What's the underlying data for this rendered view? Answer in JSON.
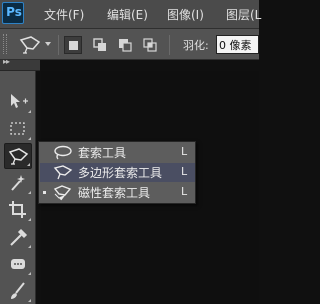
{
  "app": {
    "logo_text": "Ps",
    "brand_color": "#2e82c6"
  },
  "menubar": {
    "items": [
      {
        "label": "文件(F)"
      },
      {
        "label": "编辑(E)"
      },
      {
        "label": "图像(I)"
      },
      {
        "label": "图层(L"
      }
    ]
  },
  "options_bar": {
    "feather_label": "羽化:",
    "feather_value": "0 像素",
    "selection_modes": [
      "new-selection",
      "add-to-selection",
      "subtract-from-selection",
      "intersect-with-selection"
    ]
  },
  "toolbox": {
    "header_glyph": "▸▸",
    "tools": [
      {
        "icon": "move-icon"
      },
      {
        "icon": "marquee-icon"
      },
      {
        "icon": "polygonal-lasso-icon",
        "active": true
      },
      {
        "icon": "magic-wand-icon"
      },
      {
        "icon": "crop-icon"
      },
      {
        "icon": "eyedropper-icon"
      },
      {
        "icon": "spot-healing-icon"
      },
      {
        "icon": "brush-icon"
      }
    ]
  },
  "flyout": {
    "items": [
      {
        "label": "套索工具",
        "shortcut": "L",
        "icon": "lasso-icon"
      },
      {
        "label": "多边形套索工具",
        "shortcut": "L",
        "icon": "polygonal-lasso-icon",
        "highlighted": true
      },
      {
        "label": "磁性套索工具",
        "shortcut": "L",
        "icon": "magnetic-lasso-icon",
        "current": true
      }
    ]
  }
}
